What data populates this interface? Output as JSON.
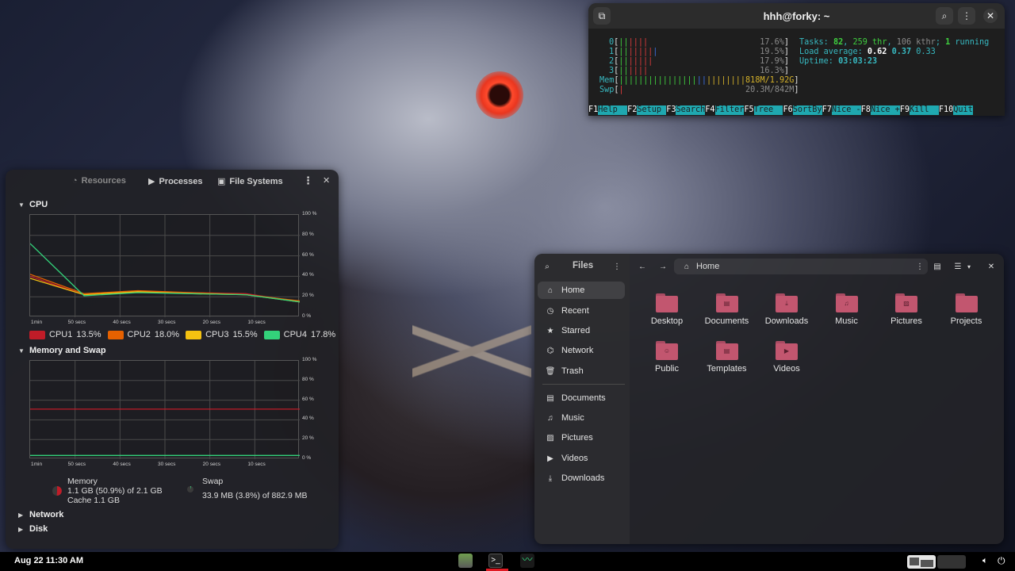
{
  "terminal": {
    "title": "hhh@forky: ~",
    "cpus": [
      {
        "id": "0",
        "pct": "17.6%"
      },
      {
        "id": "1",
        "pct": "19.5%"
      },
      {
        "id": "2",
        "pct": "17.9%"
      },
      {
        "id": "3",
        "pct": "16.3%"
      }
    ],
    "mem_label": "Mem",
    "mem_value": "818M/1.92G",
    "swp_label": "Swp",
    "swp_value": "20.3M/842M",
    "tasks_label": "Tasks:",
    "tasks_count": "82",
    "tasks_thr": "259 thr",
    "tasks_kthr": "106 kthr",
    "running_count": "1",
    "running_label": "running",
    "load_label": "Load average:",
    "load_1": "0.62",
    "load_5": "0.37",
    "load_15": "0.33",
    "uptime_label": "Uptime:",
    "uptime": "03:03:23",
    "fkeys": [
      {
        "key": "F1",
        "label": "Help  "
      },
      {
        "key": "F2",
        "label": "Setup "
      },
      {
        "key": "F3",
        "label": "Search"
      },
      {
        "key": "F4",
        "label": "Filter"
      },
      {
        "key": "F5",
        "label": "Tree  "
      },
      {
        "key": "F6",
        "label": "SortBy"
      },
      {
        "key": "F7",
        "label": "Nice -"
      },
      {
        "key": "F8",
        "label": "Nice +"
      },
      {
        "key": "F9",
        "label": "Kill  "
      },
      {
        "key": "F10",
        "label": "Quit"
      }
    ]
  },
  "sysmon": {
    "tabs": [
      "Resources",
      "Processes",
      "File Systems"
    ],
    "cpu_section": "CPU",
    "mem_section": "Memory and Swap",
    "network_section": "Network",
    "disk_section": "Disk",
    "y_ticks": [
      "100 %",
      "80 %",
      "60 %",
      "40 %",
      "20 %",
      "0 %"
    ],
    "x_ticks": [
      "1min",
      "50 secs",
      "40 secs",
      "30 secs",
      "20 secs",
      "10 secs"
    ],
    "cpu_legend": [
      {
        "name": "CPU1",
        "value": "13.5%",
        "color": "#c01c28"
      },
      {
        "name": "CPU2",
        "value": "18.0%",
        "color": "#e66100"
      },
      {
        "name": "CPU3",
        "value": "15.5%",
        "color": "#f5c211"
      },
      {
        "name": "CPU4",
        "value": "17.8%",
        "color": "#33d17a"
      }
    ],
    "memory_label": "Memory",
    "memory_usage": "1.1 GB (50.9%) of 2.1 GB",
    "memory_cache": "Cache 1.1 GB",
    "swap_label": "Swap",
    "swap_usage": "33.9 MB (3.8%) of 882.9 MB"
  },
  "chart_data": [
    {
      "type": "line",
      "title": "CPU",
      "x": [
        "1min",
        "50 secs",
        "40 secs",
        "30 secs",
        "20 secs",
        "10 secs"
      ],
      "ylim": [
        0,
        100
      ],
      "series": [
        {
          "name": "CPU1",
          "values": [
            40,
            22,
            25,
            24,
            23,
            15
          ]
        },
        {
          "name": "CPU2",
          "values": [
            42,
            23,
            26,
            24,
            22,
            16
          ]
        },
        {
          "name": "CPU3",
          "values": [
            38,
            22,
            25,
            23,
            22,
            15
          ]
        },
        {
          "name": "CPU4",
          "values": [
            72,
            21,
            24,
            23,
            22,
            15
          ]
        }
      ]
    },
    {
      "type": "line",
      "title": "Memory and Swap",
      "x": [
        "1min",
        "50 secs",
        "40 secs",
        "30 secs",
        "20 secs",
        "10 secs"
      ],
      "ylim": [
        0,
        100
      ],
      "series": [
        {
          "name": "Memory",
          "values": [
            50.9,
            50.9,
            50.9,
            50.9,
            50.9,
            50.9
          ]
        },
        {
          "name": "Swap",
          "values": [
            3.8,
            3.8,
            3.8,
            3.8,
            3.8,
            3.8
          ]
        }
      ]
    }
  ],
  "files": {
    "title": "Files",
    "path": "Home",
    "sidebar": [
      {
        "label": "Home",
        "icon": "home-icon"
      },
      {
        "label": "Recent",
        "icon": "clock-icon"
      },
      {
        "label": "Starred",
        "icon": "star-icon"
      },
      {
        "label": "Network",
        "icon": "network-icon"
      },
      {
        "label": "Trash",
        "icon": "trash-icon"
      },
      {
        "label": "Documents",
        "icon": "document-icon"
      },
      {
        "label": "Music",
        "icon": "music-icon"
      },
      {
        "label": "Pictures",
        "icon": "picture-icon"
      },
      {
        "label": "Videos",
        "icon": "video-icon"
      },
      {
        "label": "Downloads",
        "icon": "download-icon"
      }
    ],
    "folders": [
      "Desktop",
      "Documents",
      "Downloads",
      "Music",
      "Pictures",
      "Projects",
      "Public",
      "Templates",
      "Videos"
    ],
    "folder_color": "#c2566f"
  },
  "taskbar": {
    "clock": "Aug 22  11:30 AM"
  }
}
